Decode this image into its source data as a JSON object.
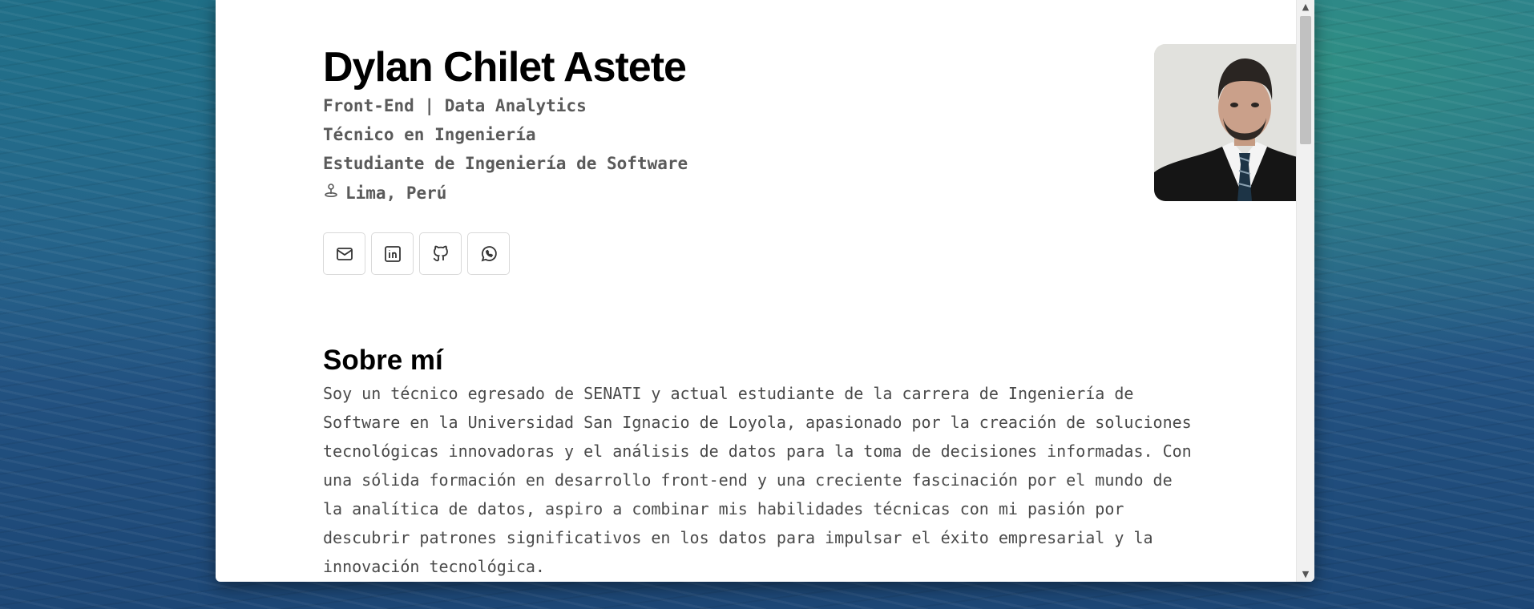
{
  "profile": {
    "name": "Dylan Chilet Astete",
    "roles": [
      "Front-End | Data Analytics",
      "Técnico en Ingeniería",
      "Estudiante de Ingeniería de Software"
    ],
    "location": "Lima, Perú",
    "location_icon": "pin-icon"
  },
  "socials": [
    {
      "icon": "mail-icon"
    },
    {
      "icon": "linkedin-icon"
    },
    {
      "icon": "github-icon"
    },
    {
      "icon": "whatsapp-icon"
    }
  ],
  "about": {
    "heading": "Sobre mí",
    "text": "Soy un técnico egresado de SENATI y actual estudiante de la carrera de Ingeniería de Software en la Universidad San Ignacio de Loyola, apasionado por la creación de soluciones tecnológicas innovadoras y el análisis de datos para la toma de decisiones informadas. Con una sólida formación en desarrollo front-end y una creciente fascinación por el mundo de la analítica de datos, aspiro a combinar mis habilidades técnicas con mi pasión por descubrir patrones significativos en los datos para impulsar el éxito empresarial y la innovación tecnológica."
  },
  "colors": {
    "text_dark": "#000000",
    "text_muted": "#5a5a5a",
    "border": "#d9d9d9"
  }
}
